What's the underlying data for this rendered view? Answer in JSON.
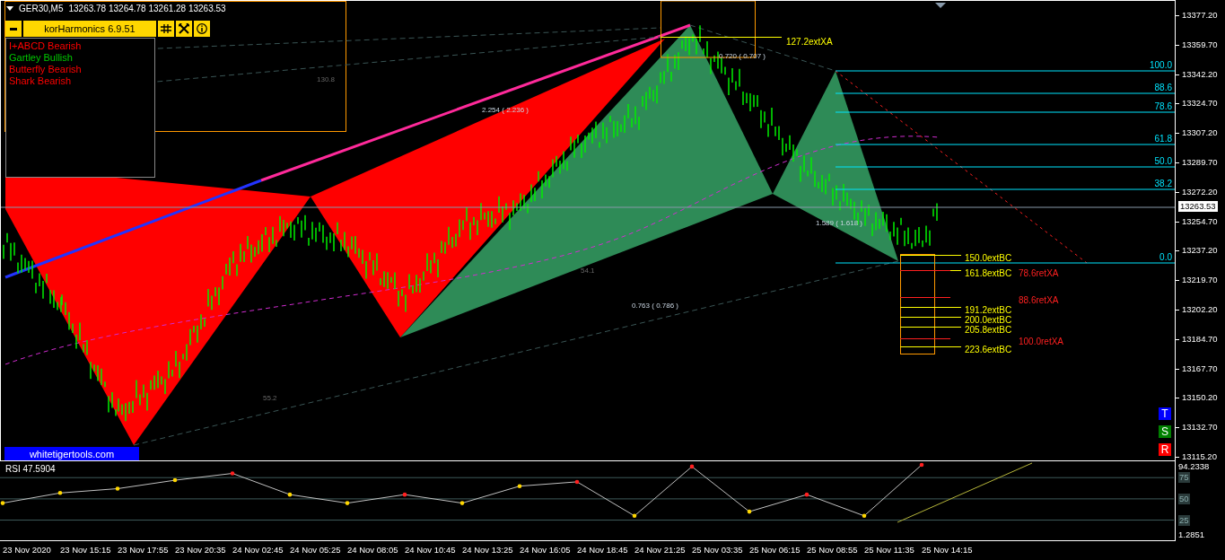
{
  "header": {
    "symbol": "GER30,M5",
    "quote": "13263.78 13264.78 13261.28 13263.53"
  },
  "indicator_panel": {
    "title": "korHarmonics 6.9.51",
    "patterns": [
      {
        "label": "I+ABCD Bearish",
        "color": "#ff0000"
      },
      {
        "label": "Gartley Bullish",
        "color": "#00c800"
      },
      {
        "label": "Butterfly Bearish",
        "color": "#ff0000"
      },
      {
        "label": "Shark Bearish",
        "color": "#ff0000"
      }
    ]
  },
  "price_chart": {
    "price_axis": [
      "13377.20",
      "13359.70",
      "13342.20",
      "13324.70",
      "13307.20",
      "13289.70",
      "13272.20",
      "13254.70",
      "13237.20",
      "13219.70",
      "13202.20",
      "13184.70",
      "13167.70",
      "13150.20",
      "13132.70",
      "13115.20"
    ],
    "current_price": "13263.53",
    "fibonacci": [
      "100.0",
      "88.6",
      "78.6",
      "61.8",
      "50.0",
      "38.2",
      "0.0"
    ],
    "xa_extension": "127.2extXA",
    "projections": [
      {
        "label": "150.0extBC",
        "kind": "ext"
      },
      {
        "label": "161.8extBC",
        "kind": "ext"
      },
      {
        "label": "78.6retXA",
        "kind": "ret"
      },
      {
        "label": "88.6retXA",
        "kind": "ret"
      },
      {
        "label": "191.2extBC",
        "kind": "ext"
      },
      {
        "label": "200.0extBC",
        "kind": "ext"
      },
      {
        "label": "205.8extBC",
        "kind": "ext"
      },
      {
        "label": "100.0retXA",
        "kind": "ret"
      },
      {
        "label": "223.6extBC",
        "kind": "ext"
      }
    ],
    "ratio_labels": [
      {
        "text": "130.8",
        "kind": "percent"
      },
      {
        "text": "2.254 ( 2.236 )",
        "kind": "ratio"
      },
      {
        "text": "0.720 ( 0.707 )",
        "kind": "ratio"
      },
      {
        "text": "54.1",
        "kind": "percent"
      },
      {
        "text": "1.589 ( 1.618 )",
        "kind": "ratio"
      },
      {
        "text": "0.763 ( 0.786 )",
        "kind": "ratio"
      },
      {
        "text": "55.2",
        "kind": "percent"
      }
    ],
    "site_button": "whitetigertools.com",
    "side_buttons": [
      {
        "label": "T",
        "color": "#0000ff"
      },
      {
        "label": "S",
        "color": "#008000"
      },
      {
        "label": "R",
        "color": "#ff0000"
      }
    ]
  },
  "rsi_chart": {
    "chart_data": {
      "type": "line",
      "title": "RSI 47.5904",
      "categories": [
        "23 Nov 2020",
        "23 Nov 15:15",
        "23 Nov 17:55",
        "23 Nov 20:35",
        "24 Nov 02:45",
        "24 Nov 05:25",
        "24 Nov 08:05",
        "24 Nov 10:45",
        "24 Nov 13:25",
        "24 Nov 16:05",
        "24 Nov 18:45",
        "24 Nov 21:25",
        "25 Nov 03:35",
        "25 Nov 06:15",
        "25 Nov 08:55",
        "25 Nov 11:35",
        "25 Nov 14:15"
      ],
      "series": [
        {
          "color": "#c0c0c0",
          "values": [
            45,
            57,
            62,
            72,
            80,
            55,
            45,
            55,
            45,
            65,
            70,
            30,
            88,
            35,
            55,
            30,
            90
          ]
        }
      ],
      "ylim": [
        1.2851,
        94.2338
      ],
      "grid": true,
      "yticks": [
        {
          "value": 94.2338,
          "label": "94.2338"
        },
        {
          "value": 75,
          "label": "75"
        },
        {
          "value": 50,
          "label": "50"
        },
        {
          "value": 25,
          "label": "25"
        },
        {
          "value": 1.2851,
          "label": "1.2851"
        }
      ]
    }
  }
}
